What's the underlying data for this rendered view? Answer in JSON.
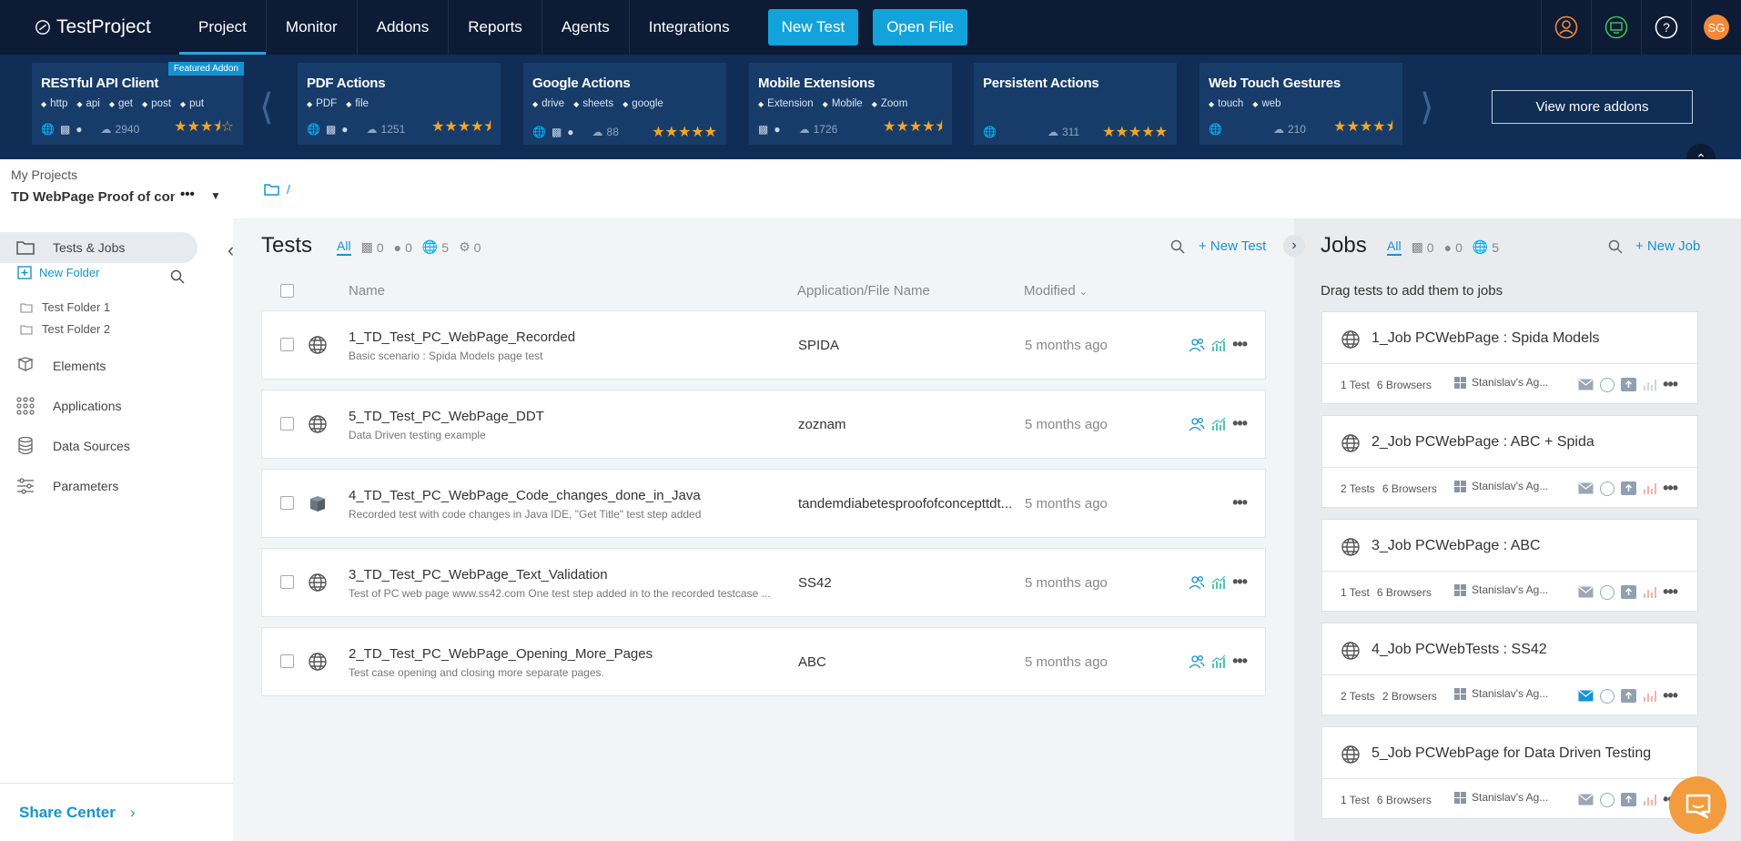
{
  "brand": {
    "name": "TestProject"
  },
  "nav": {
    "items": [
      "Project",
      "Monitor",
      "Addons",
      "Reports",
      "Agents",
      "Integrations"
    ],
    "active": "Project",
    "new_test": "New Test",
    "open_file": "Open File",
    "user_initials": "SG"
  },
  "addons": {
    "view_more": "View more addons",
    "featured_label": "Featured Addon",
    "items": [
      {
        "name": "RESTful API Client",
        "tags": [
          "http",
          "api",
          "get",
          "post",
          "put"
        ],
        "downloads": "2940",
        "rating": 3.5
      },
      {
        "name": "PDF Actions",
        "tags": [
          "PDF",
          "file"
        ],
        "downloads": "1251",
        "rating": 4.5
      },
      {
        "name": "Google Actions",
        "tags": [
          "drive",
          "sheets",
          "google"
        ],
        "downloads": "88",
        "rating": 5
      },
      {
        "name": "Mobile Extensions",
        "tags": [
          "Extension",
          "Mobile",
          "Zoom"
        ],
        "downloads": "1726",
        "rating": 4.5
      },
      {
        "name": "Persistent Actions",
        "tags": [],
        "downloads": "311",
        "rating": 5
      },
      {
        "name": "Web Touch Gestures",
        "tags": [
          "touch",
          "web"
        ],
        "downloads": "210",
        "rating": 4.5
      }
    ]
  },
  "sidebar": {
    "my_projects": "My Projects",
    "project_name": "TD WebPage Proof of con...",
    "tests_jobs": "Tests & Jobs",
    "new_folder": "New Folder",
    "folders": [
      "Test Folder 1",
      "Test Folder 2"
    ],
    "items": [
      "Elements",
      "Applications",
      "Data Sources",
      "Parameters"
    ],
    "share_center": "Share Center"
  },
  "breadcrumb": {
    "separator": "/"
  },
  "tests": {
    "title": "Tests",
    "filter_all": "All",
    "filter_counts": {
      "android": "0",
      "ios": "0",
      "web": "5",
      "generic": "0"
    },
    "new_test": "+ New Test",
    "columns": {
      "name": "Name",
      "app": "Application/File Name",
      "modified": "Modified"
    },
    "rows": [
      {
        "name": "1_TD_Test_PC_WebPage_Recorded",
        "desc": "Basic scenario : Spida Models page test",
        "app": "SPIDA",
        "modified": "5 months ago",
        "type": "web"
      },
      {
        "name": "5_TD_Test_PC_WebPage_DDT",
        "desc": "Data Driven testing example",
        "app": "zoznam",
        "modified": "5 months ago",
        "type": "web"
      },
      {
        "name": "4_TD_Test_PC_WebPage_Code_changes_done_in_Java",
        "desc": "Recorded test with code changes in Java IDE, \"Get Title\" test step added",
        "app": "tandemdiabetesproofofconcepttdt...",
        "modified": "5 months ago",
        "type": "code"
      },
      {
        "name": "3_TD_Test_PC_WebPage_Text_Validation",
        "desc": "Test of PC web page www.ss42.com One test step added in to the recorded testcase ...",
        "app": "SS42",
        "modified": "5 months ago",
        "type": "web"
      },
      {
        "name": "2_TD_Test_PC_WebPage_Opening_More_Pages",
        "desc": "Test case opening and closing more separate pages.",
        "app": "ABC",
        "modified": "5 months ago",
        "type": "web"
      }
    ]
  },
  "jobs": {
    "title": "Jobs",
    "filter_all": "All",
    "filter_counts": {
      "android": "0",
      "ios": "0",
      "web": "5"
    },
    "new_job": "+ New Job",
    "hint": "Drag tests to add them to jobs",
    "items": [
      {
        "name": "1_Job PCWebPage : Spida Models",
        "tests": "1 Test",
        "browsers": "6 Browsers",
        "agent": "Stanislav's Ag...",
        "mail_active": false
      },
      {
        "name": "2_Job PCWebPage : ABC + Spida",
        "tests": "2 Tests",
        "browsers": "6 Browsers",
        "agent": "Stanislav's Ag...",
        "mail_active": false
      },
      {
        "name": "3_Job PCWebPage : ABC",
        "tests": "1 Test",
        "browsers": "6 Browsers",
        "agent": "Stanislav's Ag...",
        "mail_active": false
      },
      {
        "name": "4_Job PCWebTests : SS42",
        "tests": "2 Tests",
        "browsers": "2 Browsers",
        "agent": "Stanislav's Ag...",
        "mail_active": true
      },
      {
        "name": "5_Job PCWebPage for Data Driven Testing",
        "tests": "1 Test",
        "browsers": "6 Browsers",
        "agent": "Stanislav's Ag...",
        "mail_active": false
      }
    ]
  },
  "colors": {
    "nav_bg": "#0d1b35",
    "addon_bg": "#102d55",
    "accent": "#1593d1",
    "star": "#f5a623"
  }
}
